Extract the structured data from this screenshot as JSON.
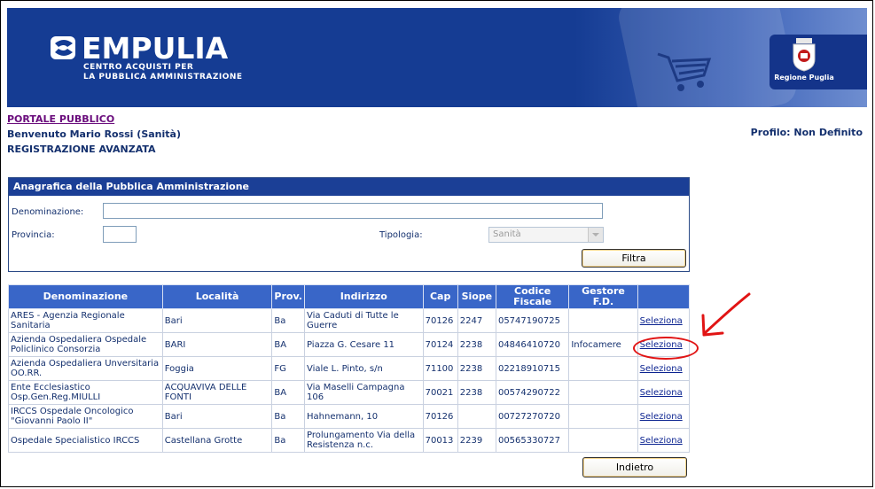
{
  "header": {
    "brand_name": "EMPULIA",
    "brand_sub_line1": "CENTRO ACQUISTI PER",
    "brand_sub_line2": "LA PUBBLICA AMMINISTRAZIONE",
    "region_label": "Regione Puglia",
    "colors": {
      "banner": "#153c93",
      "table_header": "#3966c8",
      "annotation": "#e11414"
    }
  },
  "top": {
    "portal_link": "PORTALE PUBBLICO",
    "welcome": "Benvenuto Mario Rossi (Sanità)",
    "page_subtitle": "REGISTRAZIONE AVANZATA",
    "profile": "Profilo: Non Definito"
  },
  "filter": {
    "title": "Anagrafica della Pubblica Amministrazione",
    "denominazione_label": "Denominazione:",
    "denominazione_value": "",
    "provincia_label": "Provincia:",
    "provincia_value": "",
    "tipologia_label": "Tipologia:",
    "tipologia_value": "Sanità",
    "filter_button": "Filtra"
  },
  "table": {
    "columns": [
      "Denominazione",
      "Località",
      "Prov.",
      "Indirizzo",
      "Cap",
      "Siope",
      "Codice Fiscale",
      "Gestore F.D.",
      ""
    ],
    "rows": [
      {
        "denominazione": "ARES - Agenzia Regionale Sanitaria",
        "localita": "Bari",
        "prov": "Ba",
        "indirizzo": "Via Caduti di Tutte le Guerre",
        "cap": "70126",
        "siope": "2247",
        "cf": "05747190725",
        "gestore": "",
        "action": "Seleziona"
      },
      {
        "denominazione": "Azienda Ospedaliera Ospedale Policlinico Consorzia",
        "localita": "BARI",
        "prov": "BA",
        "indirizzo": "Piazza G. Cesare 11",
        "cap": "70124",
        "siope": "2238",
        "cf": "04846410720",
        "gestore": "Infocamere",
        "action": "Seleziona"
      },
      {
        "denominazione": "Azienda Ospedaliera Unversitaria OO.RR.",
        "localita": "Foggia",
        "prov": "FG",
        "indirizzo": "Viale L. Pinto, s/n",
        "cap": "71100",
        "siope": "2238",
        "cf": "02218910715",
        "gestore": "",
        "action": "Seleziona"
      },
      {
        "denominazione": "Ente Ecclesiastico Osp.Gen.Reg.MIULLI",
        "localita": "ACQUAVIVA DELLE FONTI",
        "prov": "BA",
        "indirizzo": "Via Maselli Campagna 106",
        "cap": "70021",
        "siope": "2238",
        "cf": "00574290722",
        "gestore": "",
        "action": "Seleziona"
      },
      {
        "denominazione": "IRCCS Ospedale Oncologico \"Giovanni Paolo II\"",
        "localita": "Bari",
        "prov": "Ba",
        "indirizzo": "Hahnemann, 10",
        "cap": "70126",
        "siope": "",
        "cf": "00727270720",
        "gestore": "",
        "action": "Seleziona"
      },
      {
        "denominazione": "Ospedale Specialistico IRCCS",
        "localita": "Castellana Grotte",
        "prov": "Ba",
        "indirizzo": "Prolungamento Via della Resistenza n.c.",
        "cap": "70013",
        "siope": "2239",
        "cf": "00565330727",
        "gestore": "",
        "action": "Seleziona"
      }
    ]
  },
  "back_button": "Indietro"
}
